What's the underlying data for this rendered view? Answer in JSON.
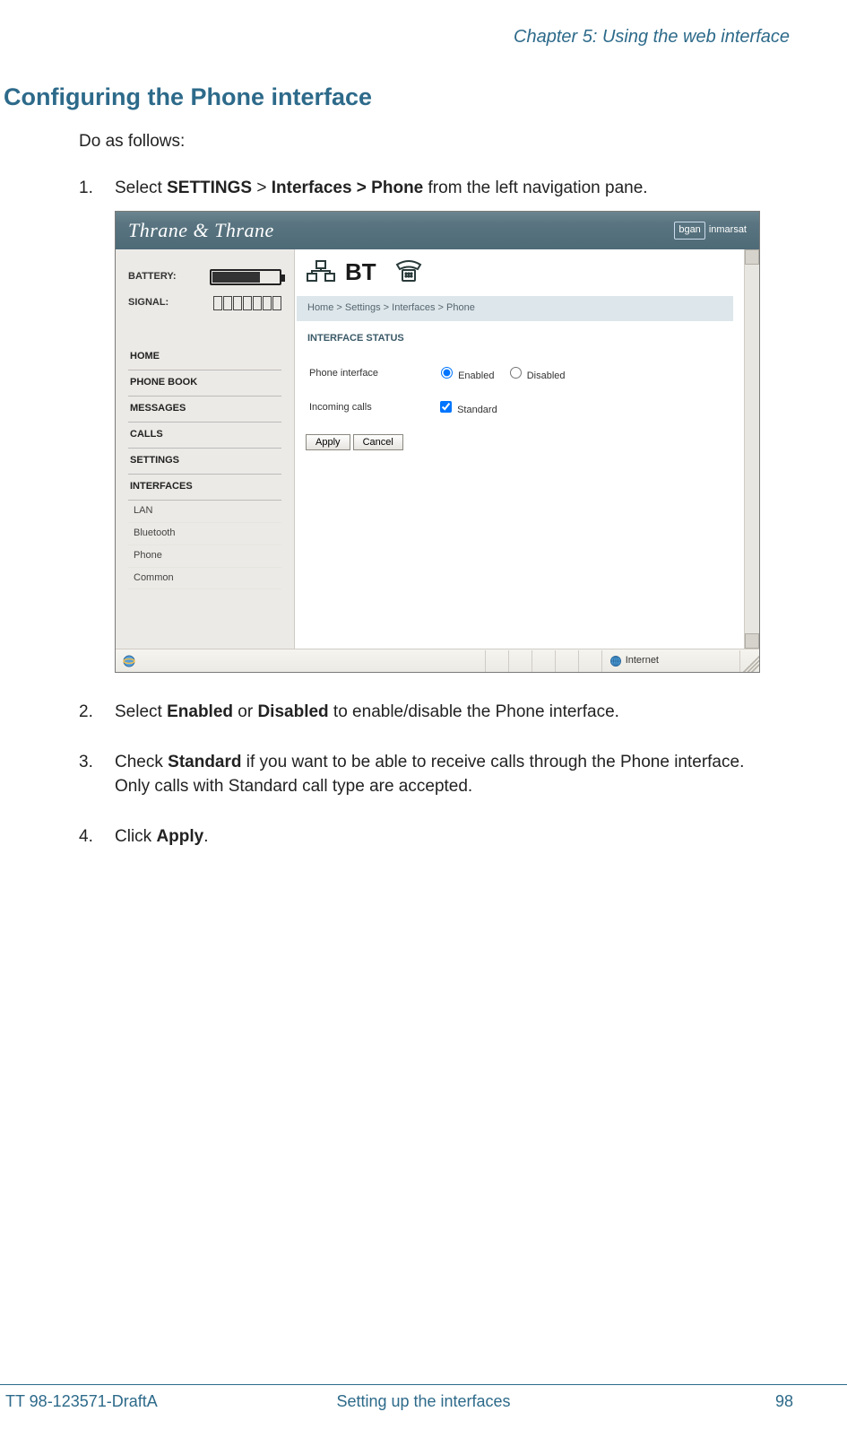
{
  "chapter_header": "Chapter 5: Using the web interface",
  "section_title": "Configuring the Phone interface",
  "intro": "Do as follows:",
  "steps": {
    "s1_pre": "Select ",
    "s1_b1": "SETTINGS",
    "s1_mid1": " > ",
    "s1_b2": "Interfaces > Phone",
    "s1_post": " from the left navigation pane.",
    "s2_pre": "Select ",
    "s2_b1": "Enabled",
    "s2_mid": " or ",
    "s2_b2": "Disabled",
    "s2_post": " to enable/disable the Phone interface.",
    "s3_pre": "Check ",
    "s3_b1": "Standard",
    "s3_post": " if you want to be able to receive calls through the Phone interface. Only calls with Standard call type are accepted.",
    "s4_pre": "Click ",
    "s4_b1": "Apply",
    "s4_post": "."
  },
  "screenshot": {
    "brand": "Thrane & Thrane",
    "logo1": "bgan",
    "logo2": "inmarsat",
    "status": {
      "battery_label": "BATTERY:",
      "signal_label": "SIGNAL:"
    },
    "nav": {
      "items": [
        "HOME",
        "PHONE BOOK",
        "MESSAGES",
        "CALLS",
        "SETTINGS",
        "INTERFACES"
      ],
      "subs": [
        "LAN",
        "Bluetooth",
        "Phone",
        "Common"
      ]
    },
    "breadcrumb": "Home > Settings > Interfaces > Phone",
    "panel": {
      "heading": "INTERFACE STATUS",
      "row1_label": "Phone interface",
      "row1_opt1": "Enabled",
      "row1_opt2": "Disabled",
      "row2_label": "Incoming calls",
      "row2_opt": "Standard",
      "apply": "Apply",
      "cancel": "Cancel"
    },
    "statusbar": {
      "zone": "Internet"
    }
  },
  "footer": {
    "left": "TT 98-123571-DraftA",
    "center": "Setting up the interfaces",
    "right": "98"
  }
}
